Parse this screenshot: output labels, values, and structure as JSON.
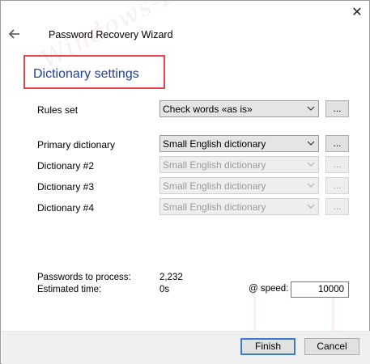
{
  "window": {
    "close_glyph": "✕",
    "title": "Password Recovery Wizard"
  },
  "section": {
    "title": "Dictionary settings"
  },
  "rules": {
    "label": "Rules set",
    "value": "Check words «as is»",
    "browse_label": "..."
  },
  "dictionaries": [
    {
      "label": "Primary dictionary",
      "value": "Small English dictionary",
      "browse_label": "...",
      "enabled": true
    },
    {
      "label": "Dictionary #2",
      "value": "Small English dictionary",
      "browse_label": "...",
      "enabled": false
    },
    {
      "label": "Dictionary #3",
      "value": "Small English dictionary",
      "browse_label": "...",
      "enabled": false
    },
    {
      "label": "Dictionary #4",
      "value": "Small English dictionary",
      "browse_label": "...",
      "enabled": false
    }
  ],
  "stats": {
    "passwords_label": "Passwords to process:",
    "passwords_value": "2,232",
    "time_label": "Estimated time:",
    "time_value": "0s",
    "speed_label": "@ speed:",
    "speed_value": "10000"
  },
  "footer": {
    "finish_label": "Finish",
    "cancel_label": "Cancel"
  },
  "colors": {
    "section_title": "#1e3f9a",
    "highlight_box": "#e0454f",
    "default_button_border": "#3b79d6"
  },
  "icons": [
    "close-icon",
    "back-arrow-icon",
    "chevron-down-icon"
  ]
}
